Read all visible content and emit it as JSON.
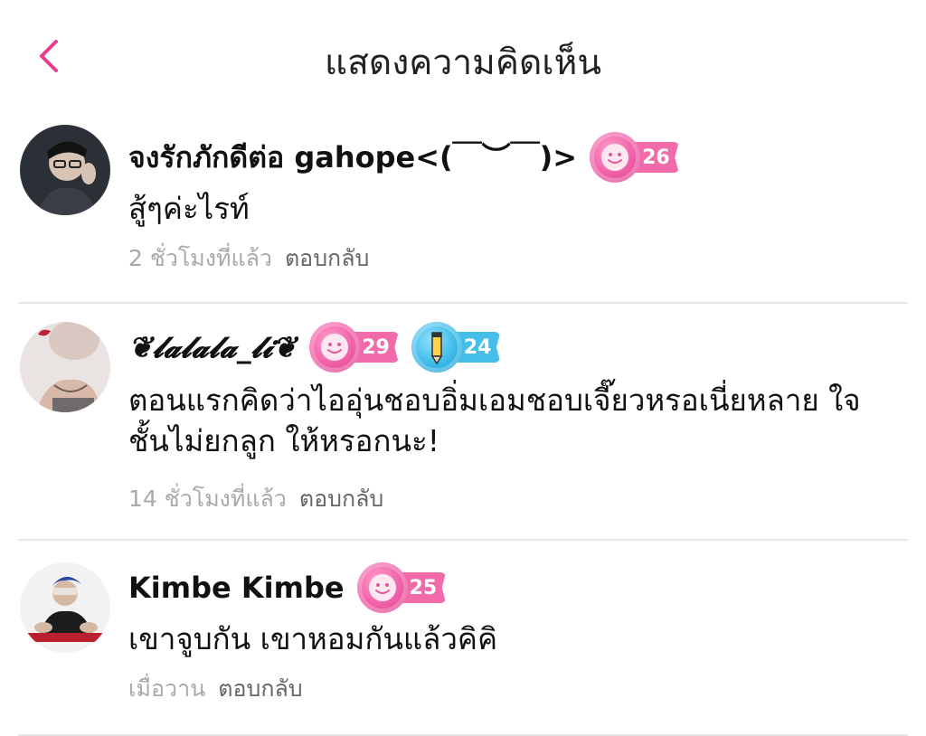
{
  "header": {
    "title": "แสดงความคิดเห็น"
  },
  "colors": {
    "accent": "#e83e8c",
    "badge_pink": "#f26aa9",
    "badge_blue": "#45bfe9"
  },
  "comments": [
    {
      "name": "จงรักภักดีต่อ gahope<(￣︶￣)>",
      "badges": [
        {
          "icon": "smiley-icon",
          "value": "26",
          "color": "pink"
        }
      ],
      "text": "สู้ๆค่ะไรท์",
      "time": "2 ชั่วโมงที่แล้ว",
      "reply": "ตอบกลับ"
    },
    {
      "name": "❦𝓵𝓪𝓵𝓪𝓵𝓪_𝓵𝓲❦",
      "badges": [
        {
          "icon": "smiley-icon",
          "value": "29",
          "color": "pink"
        },
        {
          "icon": "pencil-icon",
          "value": "24",
          "color": "blue"
        }
      ],
      "text": "ตอนแรกคิดว่าไออุ่นชอบอิ่มเอมชอบเจี๊ยวหรอเนี่ยหลาย ใจชั้นไม่ยกลูก ให้หรอกนะ!",
      "time": "14 ชั่วโมงที่แล้ว",
      "reply": "ตอบกลับ"
    },
    {
      "name": "Kimbe Kimbe",
      "badges": [
        {
          "icon": "smiley-icon",
          "value": "25",
          "color": "pink"
        }
      ],
      "text": "เขาจูบกัน เขาหอมกันแล้วคิคิ",
      "time": "เมื่อวาน",
      "reply": "ตอบกลับ"
    }
  ]
}
